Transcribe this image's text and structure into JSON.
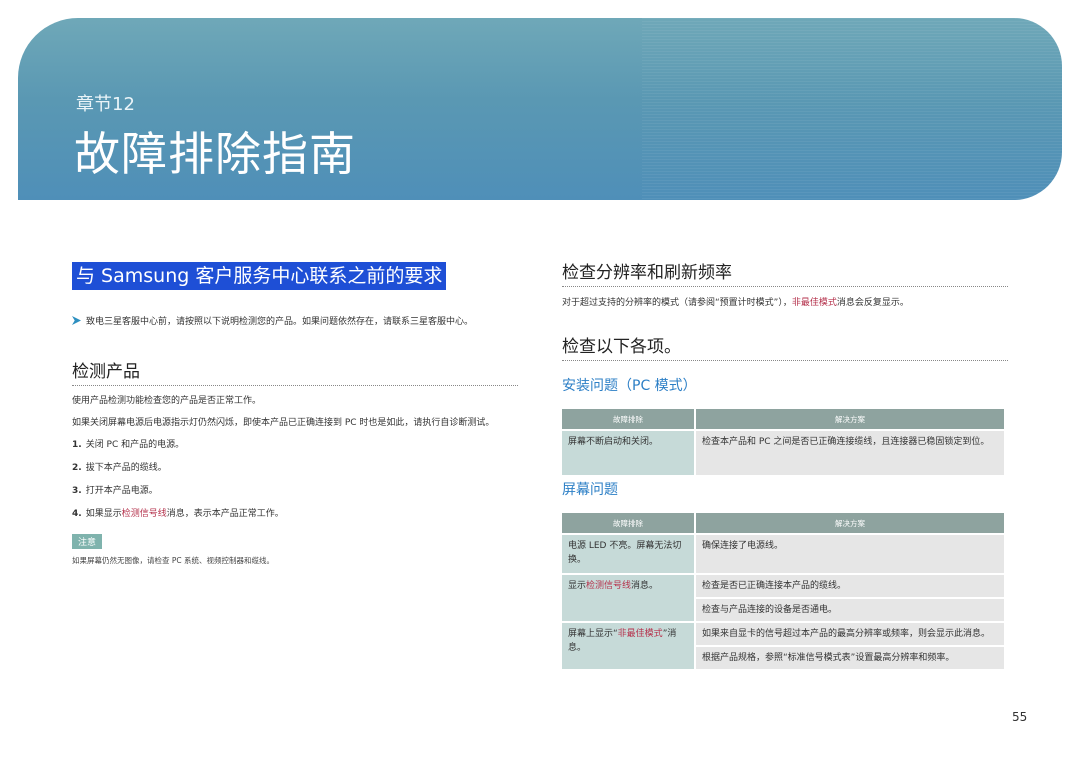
{
  "banner": {
    "chapter": "章节12",
    "title": "故障排除指南"
  },
  "left": {
    "heading": "与 Samsung 客户服务中心联系之前的要求",
    "intro": "致电三星客服中心前，请按照以下说明检测您的产品。如果问题依然存在，请联系三星客服中心。",
    "detect_heading": "检测产品",
    "para1": "使用产品检测功能检查您的产品是否正常工作。",
    "para2": "如果关闭屏幕电源后电源指示灯仍然闪烁，即使本产品已正确连接到 PC 时也是如此，请执行自诊断测试。",
    "steps": [
      {
        "num": "1.",
        "text": "关闭 PC 和产品的电源。"
      },
      {
        "num": "2.",
        "text": "拔下本产品的缆线。"
      },
      {
        "num": "3.",
        "text": "打开本产品电源。"
      },
      {
        "num": "4.",
        "pre": "如果显示",
        "red": "检测信号线",
        "post": "消息，表示本产品正常工作。"
      }
    ],
    "note_tag": "注意",
    "note_text": "如果屏幕仍然无图像，请检查 PC 系统、视频控制器和缆线。"
  },
  "right": {
    "res_heading": "检查分辨率和刷新频率",
    "res_pre": "对于超过支持的分辨率的模式（请参阅“预置计时模式”），",
    "res_red": "非最佳模式",
    "res_post": "消息会反复显示。",
    "check_heading": "检查以下各项。",
    "install_heading": "安装问题（PC 模式）",
    "screen_heading": "屏幕问题",
    "col_problem": "故障排除",
    "col_solution": "解决方案",
    "install_rows": [
      {
        "problem": "屏幕不断启动和关闭。",
        "solution": "检查本产品和 PC 之间是否已正确连接缆线，且连接器已稳固锁定到位。"
      }
    ],
    "screen_rows": [
      {
        "problem": "电源 LED 不亮。屏幕无法切换。",
        "solution": "确保连接了电源线。"
      },
      {
        "problem_pre": "显示",
        "problem_red": "检测信号线",
        "problem_post": "消息。",
        "solution": "检查是否已正确连接本产品的缆线。"
      },
      {
        "solution": "检查与产品连接的设备是否通电。"
      },
      {
        "problem_pre": "屏幕上显示“",
        "problem_red": "非最佳模式",
        "problem_post": "”消息。",
        "solution": "如果来自显卡的信号超过本产品的最高分辨率或频率，则会显示此消息。"
      },
      {
        "solution": "根据产品规格，参照“标准信号模式表”设置最高分辨率和频率。"
      }
    ]
  },
  "page_number": "55"
}
